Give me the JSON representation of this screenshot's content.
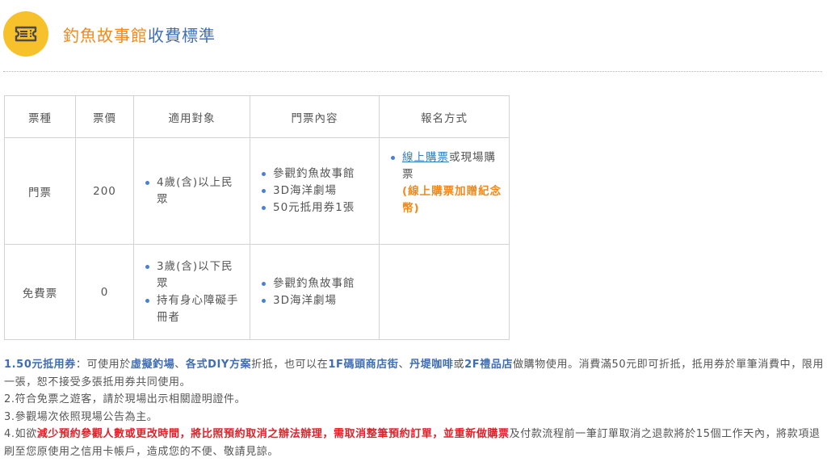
{
  "header": {
    "title_part1": "釣魚故事館",
    "title_part2": "收費標準",
    "icon": "ticket-icon",
    "accent_colors": {
      "icon_bg": "#f6c12a",
      "title_orange": "#f08a1c",
      "title_blue": "#3f6eb4",
      "bullet": "#4a80d4",
      "alert_red": "#e0212a"
    }
  },
  "table": {
    "headers": [
      "票種",
      "票價",
      "適用對象",
      "門票內容",
      "報名方式"
    ],
    "rows": [
      {
        "type": "門票",
        "price": "200",
        "eligibility": [
          "4歲(含)以上民眾"
        ],
        "contents": [
          "參觀釣魚故事館",
          "3D海洋劇場",
          "50元抵用券1張"
        ],
        "signup": {
          "link": "線上購票",
          "text": "或現場購票",
          "promo": "(線上購票加贈紀念幣)"
        }
      },
      {
        "type": "免費票",
        "price": "0",
        "eligibility": [
          "3歲(含)以下民眾",
          "持有身心障礙手冊者"
        ],
        "contents": [
          "參觀釣魚故事館",
          "3D海洋劇場"
        ]
      }
    ]
  },
  "notes": {
    "n1": {
      "a": "1.50元抵用券",
      "b": "：可使用於",
      "c": "虛擬釣場",
      "d": "、",
      "e": "各式DIY方案",
      "f": "折抵，也可以在",
      "g": "1F碼頭商店街",
      "h": "、",
      "i": "丹堤咖啡",
      "j": "或",
      "k": "2F禮品店",
      "l": "做購物使用。消費滿50元即可折抵，抵用券於單筆消費中，限用一張，恕不接受多張抵用券共同使用。"
    },
    "n2": "2.符合免票之遊客，請於現場出示相關證明證件。",
    "n3": "3.參觀場次依照現場公告為主。",
    "n4": {
      "a": "4.如欲",
      "b": "減少預約參觀人數或更改時間，將比照預約取消之辦法辦理，需取消整筆預約訂單，並重新做購票",
      "c": "及付款流程前一筆訂單取消之退款將於15個工作天內，將款項退刷至您原使用之信用卡帳戶，造成您的不便、敬請見諒。"
    }
  }
}
